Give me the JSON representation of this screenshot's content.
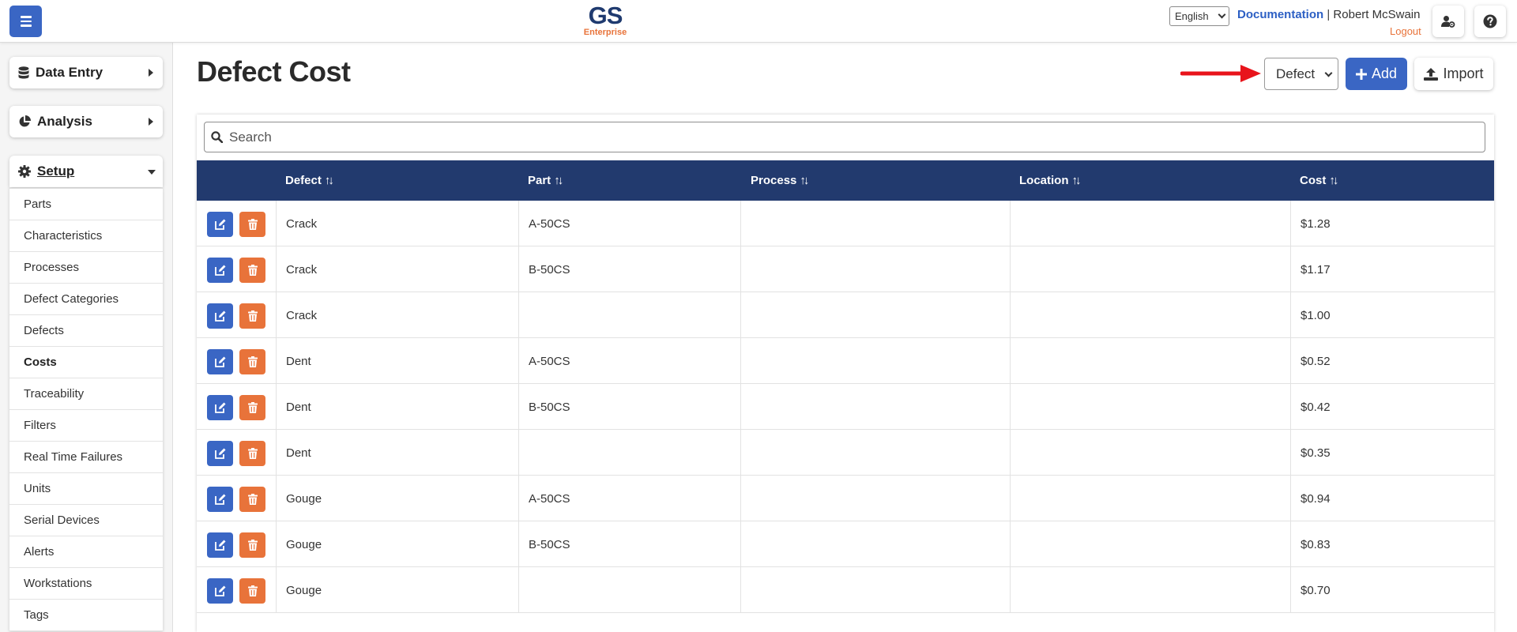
{
  "header": {
    "logo_main": "GS",
    "logo_sub": "Enterprise",
    "language": "English",
    "documentation": "Documentation",
    "separator": "|",
    "user_name": "Robert McSwain",
    "logout": "Logout"
  },
  "sidebar": {
    "data_entry": "Data Entry",
    "analysis": "Analysis",
    "setup": "Setup",
    "setup_items": [
      "Parts",
      "Characteristics",
      "Processes",
      "Defect Categories",
      "Defects",
      "Costs",
      "Traceability",
      "Filters",
      "Real Time Failures",
      "Units",
      "Serial Devices",
      "Alerts",
      "Workstations",
      "Tags"
    ],
    "active_item": "Costs"
  },
  "main": {
    "title": "Defect Cost",
    "type_select": "Defect",
    "add_label": "Add",
    "import_label": "Import",
    "search_placeholder": "Search"
  },
  "table": {
    "columns": [
      "Defect",
      "Part",
      "Process",
      "Location",
      "Cost"
    ],
    "rows": [
      {
        "defect": "Crack",
        "part": "A-50CS",
        "process": "",
        "location": "",
        "cost": "$1.28"
      },
      {
        "defect": "Crack",
        "part": "B-50CS",
        "process": "",
        "location": "",
        "cost": "$1.17"
      },
      {
        "defect": "Crack",
        "part": "",
        "process": "",
        "location": "",
        "cost": "$1.00"
      },
      {
        "defect": "Dent",
        "part": "A-50CS",
        "process": "",
        "location": "",
        "cost": "$0.52"
      },
      {
        "defect": "Dent",
        "part": "B-50CS",
        "process": "",
        "location": "",
        "cost": "$0.42"
      },
      {
        "defect": "Dent",
        "part": "",
        "process": "",
        "location": "",
        "cost": "$0.35"
      },
      {
        "defect": "Gouge",
        "part": "A-50CS",
        "process": "",
        "location": "",
        "cost": "$0.94"
      },
      {
        "defect": "Gouge",
        "part": "B-50CS",
        "process": "",
        "location": "",
        "cost": "$0.83"
      },
      {
        "defect": "Gouge",
        "part": "",
        "process": "",
        "location": "",
        "cost": "$0.70"
      }
    ]
  },
  "colors": {
    "primary": "#3a66c4",
    "accent": "#e8733a",
    "table_header": "#223a6e",
    "annotation_arrow": "#e8141b"
  }
}
